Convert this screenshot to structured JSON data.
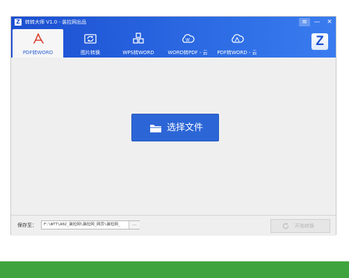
{
  "window": {
    "title": "转转大师 V1.0 - 装拉网出品",
    "menu_symbol": "≡",
    "minimize_symbol": "—",
    "close_symbol": "✕",
    "brand_letter": "Z"
  },
  "tabs": [
    {
      "label": "PDF转WORD",
      "icon": "pdf-icon",
      "active": true
    },
    {
      "label": "图片转换",
      "icon": "image-convert-icon",
      "active": false
    },
    {
      "label": "WPS转WORD",
      "icon": "wps-icon",
      "active": false
    },
    {
      "label": "WORD转PDF - 云",
      "icon": "cloud-word-icon",
      "active": false
    },
    {
      "label": "PDF转WORD - 云",
      "icon": "cloud-pdf-icon",
      "active": false
    }
  ],
  "main": {
    "select_button_label": "选择文件",
    "select_button_icon": "folder-icon"
  },
  "footer": {
    "save_label": "保存至：",
    "save_path": "F:\\WTT\\A02_装拉网\\装拉网_网页\\装拉网_",
    "browse_label": "...",
    "start_label": "开始转换"
  },
  "colors": {
    "header": "#2f6fe6",
    "accent_button": "#2c66d6",
    "green_bar": "#3fa43e"
  }
}
